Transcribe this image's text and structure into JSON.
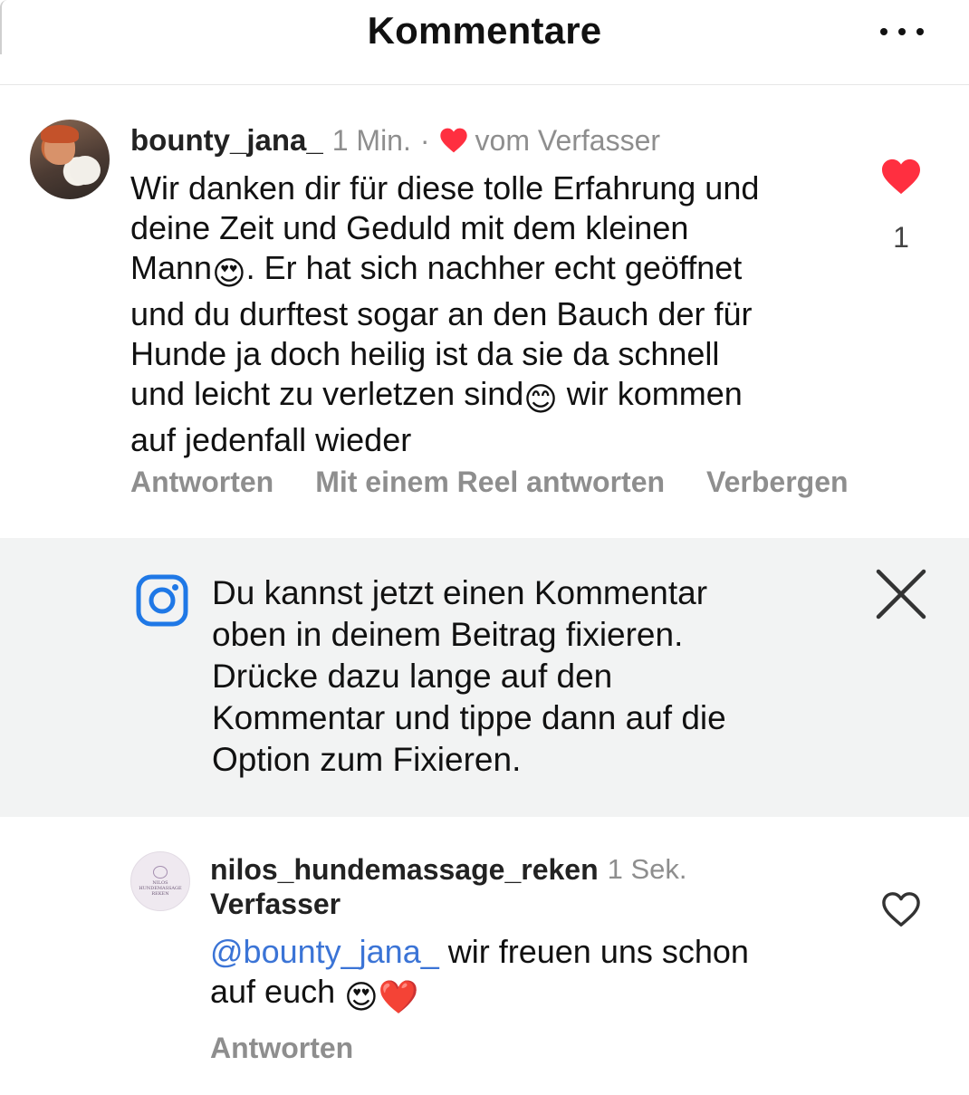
{
  "header": {
    "title": "Kommentare",
    "more_icon": "more-horizontal-icon"
  },
  "comments": [
    {
      "username": "bounty_jana_",
      "time": "1 Min.",
      "separator": "·",
      "liked_by_author_label": "vom Verfasser",
      "text_lines": [
        "Wir danken dir für diese tolle Erfahrung und",
        "deine Zeit und Geduld mit dem kleinen",
        "Mann",
        "😍",
        ". Er hat sich nachher echt geöffnet",
        "und du durftest sogar an den Bauch der für",
        "Hunde ja doch heilig ist da sie da schnell",
        "und leicht zu verletzen sind",
        "😊",
        " wir kommen",
        "auf jedenfall wieder"
      ],
      "like_count": "1",
      "actions": [
        "Antworten",
        "Mit einem Reel antworten",
        "Verbergen"
      ],
      "like_color": "#ff2f40"
    },
    {
      "username": "nilos_hundemassage_reken",
      "time": "1 Sek.",
      "author_badge": "Verfasser",
      "mention": "@bounty_jana_",
      "text_part_1": " wir freuen uns schon",
      "text_part_2": "auf euch ",
      "emoji_1": "😍",
      "emoji_2": "❤️",
      "avatar_text": [
        "NILOS",
        "HUNDEMASSAGE",
        "REKEN"
      ],
      "actions": [
        "Antworten"
      ]
    }
  ],
  "banner": {
    "text_lines": [
      "Du kannst jetzt einen Kommentar",
      "oben in deinem Beitrag fixieren.",
      "Drücke dazu lange auf den",
      "Kommentar und tippe dann auf die",
      "Option zum Fixieren."
    ],
    "icon": "instagram-icon",
    "close_icon": "close-icon",
    "accent_color": "#1f78e6"
  }
}
